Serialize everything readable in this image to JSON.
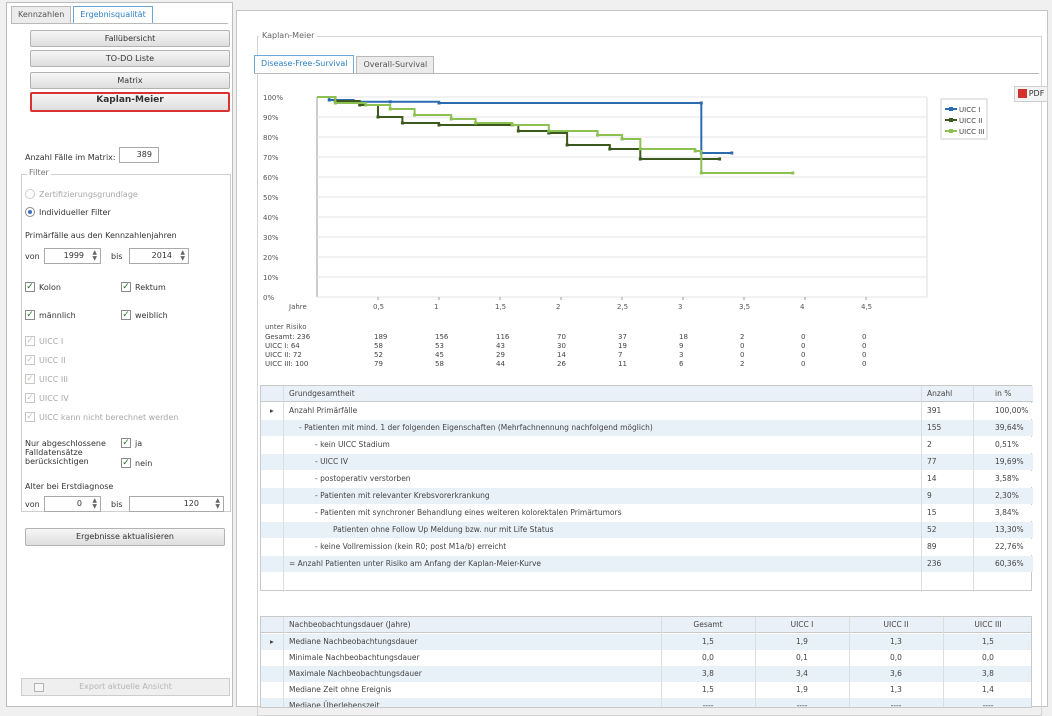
{
  "left_tabs": [
    "Kennzahlen",
    "Ergebnisqualität"
  ],
  "nav": {
    "overview": "Fallübersicht",
    "todo": "TO-DO Liste",
    "matrix": "Matrix",
    "kaplan": "Kaplan-Meier"
  },
  "matrix_count": {
    "label": "Anzahl Fälle im Matrix:",
    "value": "389"
  },
  "filter": {
    "title": "Filter",
    "radio_cert": "Zertifizierungsgrundlage",
    "radio_individual": "Individueller Filter",
    "primary_label": "Primärfälle aus den Kennzahlenjahren",
    "from_label": "von",
    "from_value": "1999",
    "to_label": "bis",
    "to_value": "2014",
    "cb_kolon": "Kolon",
    "cb_rektum": "Rektum",
    "cb_male": "männlich",
    "cb_female": "weiblich",
    "uicc": [
      "UICC I",
      "UICC II",
      "UICC III",
      "UICC IV",
      "UICC kann nicht berechnet werden"
    ],
    "completed_label": [
      "Nur abgeschlossene",
      "Falldatensätze",
      "berücksichtigen"
    ],
    "cb_ja": "ja",
    "cb_nein": "nein",
    "age_label": "Alter bei Erstdiagnose",
    "age_from_label": "von",
    "age_from": "0",
    "age_to_label": "bis",
    "age_to": "120",
    "update_button": "Ergebnisse aktualisieren"
  },
  "export_button": "Export aktuelle Ansicht",
  "main": {
    "section_title": "Kaplan-Meier",
    "tabs": [
      "Disease-Free-Survival",
      "Overall-Survival"
    ],
    "pdf_label": "PDF"
  },
  "chart_data": {
    "type": "line",
    "xlabel": "Jahre",
    "x_ticks": [
      "0,5",
      "1",
      "1,5",
      "2",
      "2,5",
      "3",
      "3,5",
      "4",
      "4,5"
    ],
    "y_ticks": [
      "100%",
      "90%",
      "80%",
      "70%",
      "60%",
      "50%",
      "40%",
      "30%",
      "20%",
      "10%",
      "0%"
    ],
    "xlim": [
      0,
      5
    ],
    "ylim": [
      0,
      100
    ],
    "series": [
      {
        "name": "UICC I",
        "color": "#2b6cb0",
        "points": [
          [
            0,
            100
          ],
          [
            0.1,
            98.5
          ],
          [
            0.3,
            97.6
          ],
          [
            0.6,
            97.6
          ],
          [
            1.0,
            97
          ],
          [
            3.15,
            97
          ],
          [
            3.15,
            72
          ],
          [
            3.4,
            72
          ]
        ]
      },
      {
        "name": "UICC II",
        "color": "#3d5a1e",
        "points": [
          [
            0,
            100
          ],
          [
            0.15,
            98
          ],
          [
            0.35,
            96
          ],
          [
            0.5,
            90
          ],
          [
            0.7,
            87
          ],
          [
            1.0,
            86
          ],
          [
            1.6,
            86
          ],
          [
            1.65,
            83
          ],
          [
            1.9,
            82
          ],
          [
            2.05,
            76
          ],
          [
            2.4,
            74
          ],
          [
            2.65,
            69
          ],
          [
            3.3,
            69
          ]
        ]
      },
      {
        "name": "UICC III",
        "color": "#8cc152",
        "points": [
          [
            0,
            100
          ],
          [
            0.15,
            97
          ],
          [
            0.4,
            96
          ],
          [
            0.6,
            94
          ],
          [
            0.8,
            91
          ],
          [
            1.1,
            89
          ],
          [
            1.3,
            87
          ],
          [
            1.6,
            86
          ],
          [
            1.9,
            83
          ],
          [
            2.3,
            81
          ],
          [
            2.5,
            79
          ],
          [
            2.65,
            74
          ],
          [
            3.1,
            73
          ],
          [
            3.15,
            62
          ],
          [
            3.9,
            62
          ]
        ]
      }
    ]
  },
  "risk": {
    "title": "unter Risiko",
    "rows": [
      {
        "label": "Gesamt: 236",
        "values": [
          "189",
          "156",
          "116",
          "70",
          "37",
          "18",
          "2",
          "0",
          "0"
        ]
      },
      {
        "label": "UICC I: 64",
        "values": [
          "58",
          "53",
          "43",
          "30",
          "19",
          "9",
          "0",
          "0",
          "0"
        ]
      },
      {
        "label": "UICC II: 72",
        "values": [
          "52",
          "45",
          "29",
          "14",
          "7",
          "3",
          "0",
          "0",
          "0"
        ]
      },
      {
        "label": "UICC III: 100",
        "values": [
          "79",
          "58",
          "44",
          "26",
          "11",
          "6",
          "2",
          "0",
          "0"
        ]
      }
    ]
  },
  "table1": {
    "headers": [
      "Grundgesamtheit",
      "Anzahl",
      "in %"
    ],
    "rows": [
      {
        "label": "Anzahl Primärfälle",
        "count": "391",
        "pct": "100,00%",
        "indent": 0,
        "arrow": true
      },
      {
        "label": "-  Patienten mit mind. 1 der folgenden Eigenschaften (Mehrfachnennung nachfolgend möglich)",
        "count": "155",
        "pct": "39,64%",
        "indent": 1
      },
      {
        "label": "-  kein UICC Stadium",
        "count": "2",
        "pct": "0,51%",
        "indent": 2
      },
      {
        "label": "-  UICC IV",
        "count": "77",
        "pct": "19,69%",
        "indent": 2
      },
      {
        "label": "-  postoperativ verstorben",
        "count": "14",
        "pct": "3,58%",
        "indent": 2
      },
      {
        "label": "-  Patienten mit relevanter Krebsvorerkrankung",
        "count": "9",
        "pct": "2,30%",
        "indent": 2
      },
      {
        "label": "-  Patienten mit synchroner Behandlung eines weiteren kolorektalen Primärtumors",
        "count": "15",
        "pct": "3,84%",
        "indent": 2
      },
      {
        "label": "Patienten ohne Follow Up Meldung bzw. nur mit Life Status",
        "count": "52",
        "pct": "13,30%",
        "indent": 3
      },
      {
        "label": "-  keine Vollremission (kein R0; post M1a/b) erreicht",
        "count": "89",
        "pct": "22,76%",
        "indent": 2
      },
      {
        "label": "= Anzahl Patienten unter Risiko am Anfang der Kaplan-Meier-Kurve",
        "count": "236",
        "pct": "60,36%",
        "indent": 0
      }
    ]
  },
  "table2": {
    "headers": [
      "Nachbeobachtungsdauer (Jahre)",
      "Gesamt",
      "UICC I",
      "UICC II",
      "UICC III"
    ],
    "rows": [
      {
        "label": "Mediane Nachbeobachtungsdauer",
        "values": [
          "1,5",
          "1,9",
          "1,3",
          "1,5"
        ],
        "arrow": true
      },
      {
        "label": "Minimale Nachbeobachtungsdauer",
        "values": [
          "0,0",
          "0,1",
          "0,0",
          "0,0"
        ]
      },
      {
        "label": "Maximale Nachbeobachtungsdauer",
        "values": [
          "3,8",
          "3,4",
          "3,6",
          "3,8"
        ]
      },
      {
        "label": "Mediane Zeit ohne Ereignis",
        "values": [
          "1,5",
          "1,9",
          "1,3",
          "1,4"
        ]
      },
      {
        "label": "Mediane Überlebenszeit",
        "values": [
          "----",
          "----",
          "----",
          "----"
        ]
      }
    ]
  }
}
